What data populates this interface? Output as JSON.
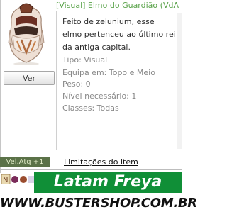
{
  "item": {
    "title": "[Visual] Elmo do Guardião (VdA",
    "description": "Feito de zelunium, esse elmo pertenceu ao último rei da antiga capital.",
    "fields": {
      "tipo": "Tipo: Visual",
      "equipa": "Equipa em: Topo e Meio",
      "peso": "Peso: 0",
      "nivel": "Nível necessário: 1",
      "classes": "Classes: Todas"
    },
    "icon": "guardian-helm-icon"
  },
  "buttons": {
    "ver": "Ver"
  },
  "badge": {
    "vel_atq": "Vel.Atq +1"
  },
  "links": {
    "limits": "Limitações do item"
  },
  "banner": {
    "server": "Latam Freya",
    "site": "WWW.BUSTERSHOP.COM.BR"
  },
  "colors": {
    "title_green": "#5aa34a",
    "badge_bg": "#5b7248",
    "banner_green": "#108f37"
  }
}
